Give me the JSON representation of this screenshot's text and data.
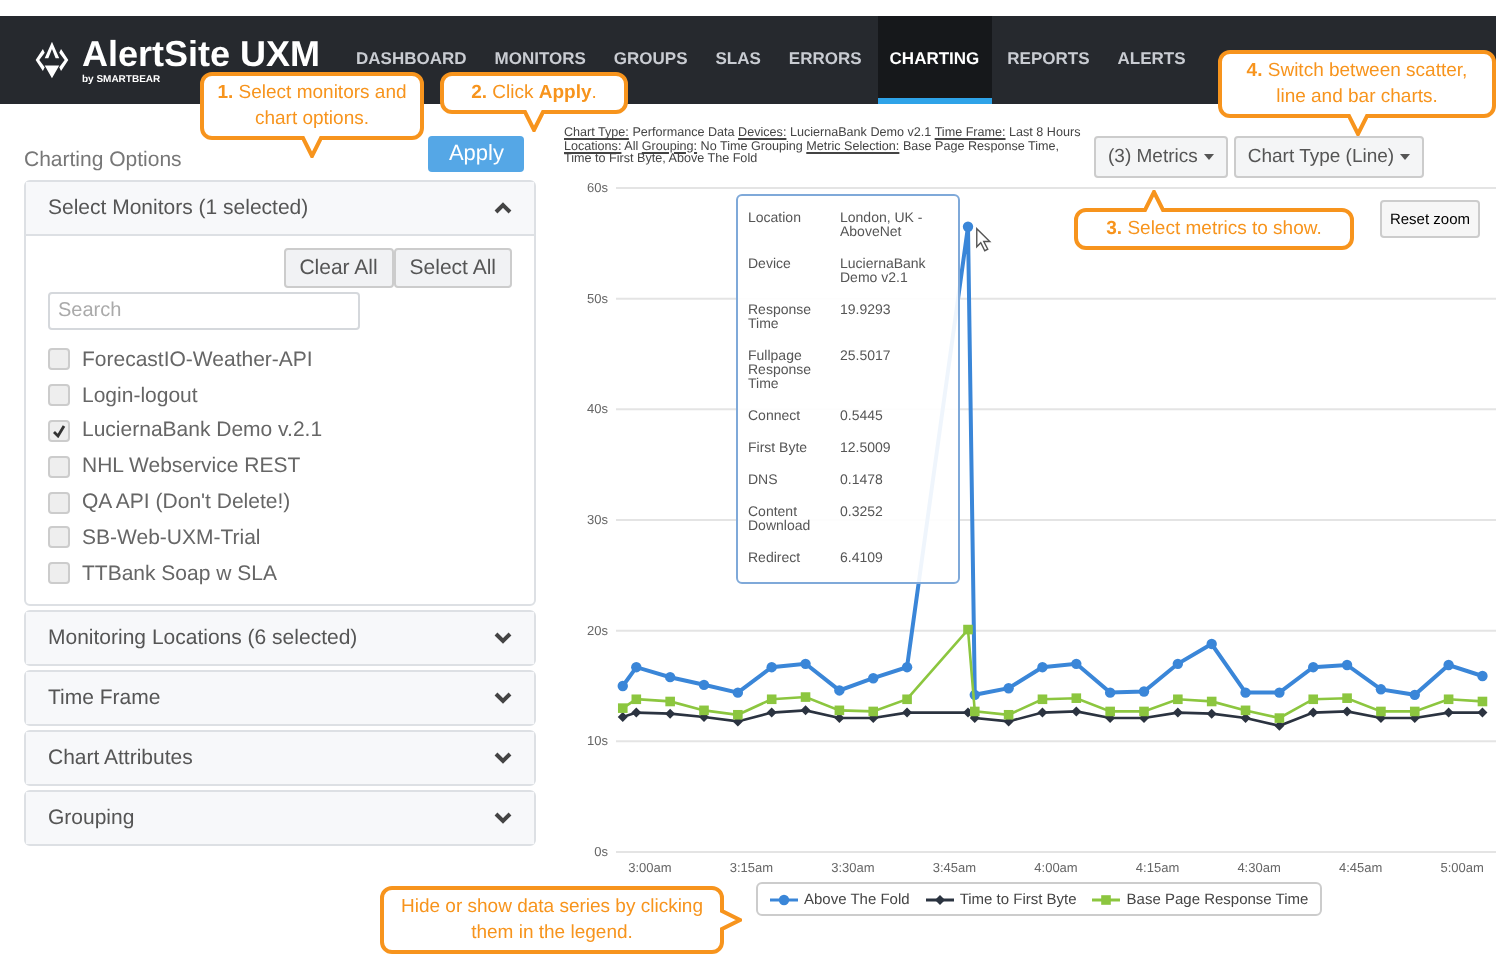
{
  "header": {
    "logo": "AlertSite UXM",
    "logo_sub": "by SMARTBEAR",
    "nav": [
      {
        "label": "DASHBOARD",
        "selected": false
      },
      {
        "label": "MONITORS",
        "selected": false
      },
      {
        "label": "GROUPS",
        "selected": false
      },
      {
        "label": "SLAS",
        "selected": false
      },
      {
        "label": "ERRORS",
        "selected": false
      },
      {
        "label": "CHARTING",
        "selected": true
      },
      {
        "label": "REPORTS",
        "selected": false
      },
      {
        "label": "ALERTS",
        "selected": false
      }
    ]
  },
  "sidebar": {
    "title": "Charting Options",
    "apply": "Apply",
    "sections": [
      {
        "title": "Select Monitors (1 selected)",
        "expanded": true,
        "clear": "Clear All",
        "select": "Select All",
        "search_placeholder": "Search",
        "monitors": [
          {
            "label": "ForecastIO-Weather-API",
            "checked": false
          },
          {
            "label": "Login-logout",
            "checked": false
          },
          {
            "label": "LuciernaBank Demo v.2.1",
            "checked": true
          },
          {
            "label": "NHL Webservice REST",
            "checked": false
          },
          {
            "label": "QA API (Don't Delete!)",
            "checked": false
          },
          {
            "label": "SB-Web-UXM-Trial",
            "checked": false
          },
          {
            "label": "TTBank Soap w SLA",
            "checked": false
          }
        ]
      },
      {
        "title": "Monitoring Locations (6 selected)",
        "expanded": false
      },
      {
        "title": "Time Frame",
        "expanded": false
      },
      {
        "title": "Chart Attributes",
        "expanded": false
      },
      {
        "title": "Grouping",
        "expanded": false
      }
    ]
  },
  "chart_panel": {
    "summary": [
      {
        "label": "Chart Type:",
        "value": "Performance Data"
      },
      {
        "label": "Devices:",
        "value": "LuciernaBank Demo v2.1"
      },
      {
        "label": "Time Frame:",
        "value": "Last 8 Hours"
      },
      {
        "label": "Locations:",
        "value": "All"
      },
      {
        "label": "Grouping:",
        "value": "No Time Grouping"
      },
      {
        "label": "Metric Selection:",
        "value": "Base Page Response Time, Time to First Byte, Above The Fold"
      }
    ],
    "metrics_button": "(3) Metrics",
    "chart_type_button": "Chart Type (Line)",
    "reset_zoom": "Reset zoom",
    "tooltip": [
      {
        "label": "Location",
        "value": "London, UK - AboveNet"
      },
      {
        "label": "Device",
        "value": "LuciernaBank Demo v2.1"
      },
      {
        "label": "Response Time",
        "value": "19.9293"
      },
      {
        "label": "Fullpage Response Time",
        "value": "25.5017"
      },
      {
        "label": "Connect",
        "value": "0.5445"
      },
      {
        "label": "First Byte",
        "value": "12.5009"
      },
      {
        "label": "DNS",
        "value": "0.1478"
      },
      {
        "label": "Content Download",
        "value": "0.3252"
      },
      {
        "label": "Redirect",
        "value": "6.4109"
      }
    ],
    "chart_data": {
      "type": "line",
      "grid": true,
      "x": [
        176,
        178,
        183,
        188,
        193,
        198,
        203,
        208,
        213,
        218,
        227,
        228,
        233,
        238,
        243,
        248,
        253,
        258,
        263,
        268,
        273,
        278,
        283,
        288,
        293,
        298,
        303
      ],
      "xlim": [
        175,
        305
      ],
      "ylim": [
        0,
        60
      ],
      "xticks": [
        {
          "value": 180,
          "label": "3:00am"
        },
        {
          "value": 195,
          "label": "3:15am"
        },
        {
          "value": 210,
          "label": "3:30am"
        },
        {
          "value": 225,
          "label": "3:45am"
        },
        {
          "value": 240,
          "label": "4:00am"
        },
        {
          "value": 255,
          "label": "4:15am"
        },
        {
          "value": 270,
          "label": "4:30am"
        },
        {
          "value": 285,
          "label": "4:45am"
        },
        {
          "value": 300,
          "label": "5:00am"
        }
      ],
      "yticks": [
        {
          "value": 0,
          "label": "0s"
        },
        {
          "value": 10,
          "label": "10s"
        },
        {
          "value": 20,
          "label": "20s"
        },
        {
          "value": 30,
          "label": "30s"
        },
        {
          "value": 40,
          "label": "40s"
        },
        {
          "value": 50,
          "label": "50s"
        },
        {
          "value": 60,
          "label": "60s"
        }
      ],
      "series": [
        {
          "name": "Above The Fold",
          "color": "#3a86d8",
          "marker": "circle",
          "values": [
            15.0,
            16.7,
            15.8,
            15.1,
            14.4,
            16.7,
            17.0,
            14.6,
            15.7,
            16.7,
            56.5,
            14.2,
            14.8,
            16.7,
            17.0,
            14.4,
            14.5,
            17.0,
            18.8,
            14.4,
            14.4,
            16.7,
            16.9,
            14.7,
            14.2,
            16.9,
            15.9
          ]
        },
        {
          "name": "Time to First Byte",
          "color": "#2b3340",
          "marker": "diamond",
          "values": [
            12.2,
            12.6,
            12.5,
            12.2,
            11.8,
            12.6,
            12.8,
            12.1,
            12.1,
            12.6,
            12.6,
            12.1,
            11.8,
            12.6,
            12.7,
            12.1,
            12.1,
            12.6,
            12.5,
            12.1,
            11.4,
            12.6,
            12.7,
            12.1,
            12.1,
            12.6,
            12.6
          ]
        },
        {
          "name": "Base Page Response Time",
          "color": "#8cc63f",
          "marker": "square",
          "values": [
            13.0,
            13.8,
            13.6,
            12.8,
            12.4,
            13.8,
            14.0,
            12.8,
            12.7,
            13.8,
            20.1,
            12.7,
            12.4,
            13.8,
            13.9,
            12.7,
            12.7,
            13.8,
            13.6,
            12.8,
            12.1,
            13.8,
            13.9,
            12.7,
            12.7,
            13.8,
            13.6
          ]
        }
      ]
    }
  },
  "callouts": [
    {
      "number": "1.",
      "text": "Select monitors and chart options."
    },
    {
      "number": "2.",
      "text": "Click **Apply**."
    },
    {
      "number": "3.",
      "text": "Select metrics to show."
    },
    {
      "number": "4.",
      "text": "Switch between scatter, line and bar charts."
    },
    {
      "text": "Hide or show data series by clicking them in the legend."
    }
  ]
}
